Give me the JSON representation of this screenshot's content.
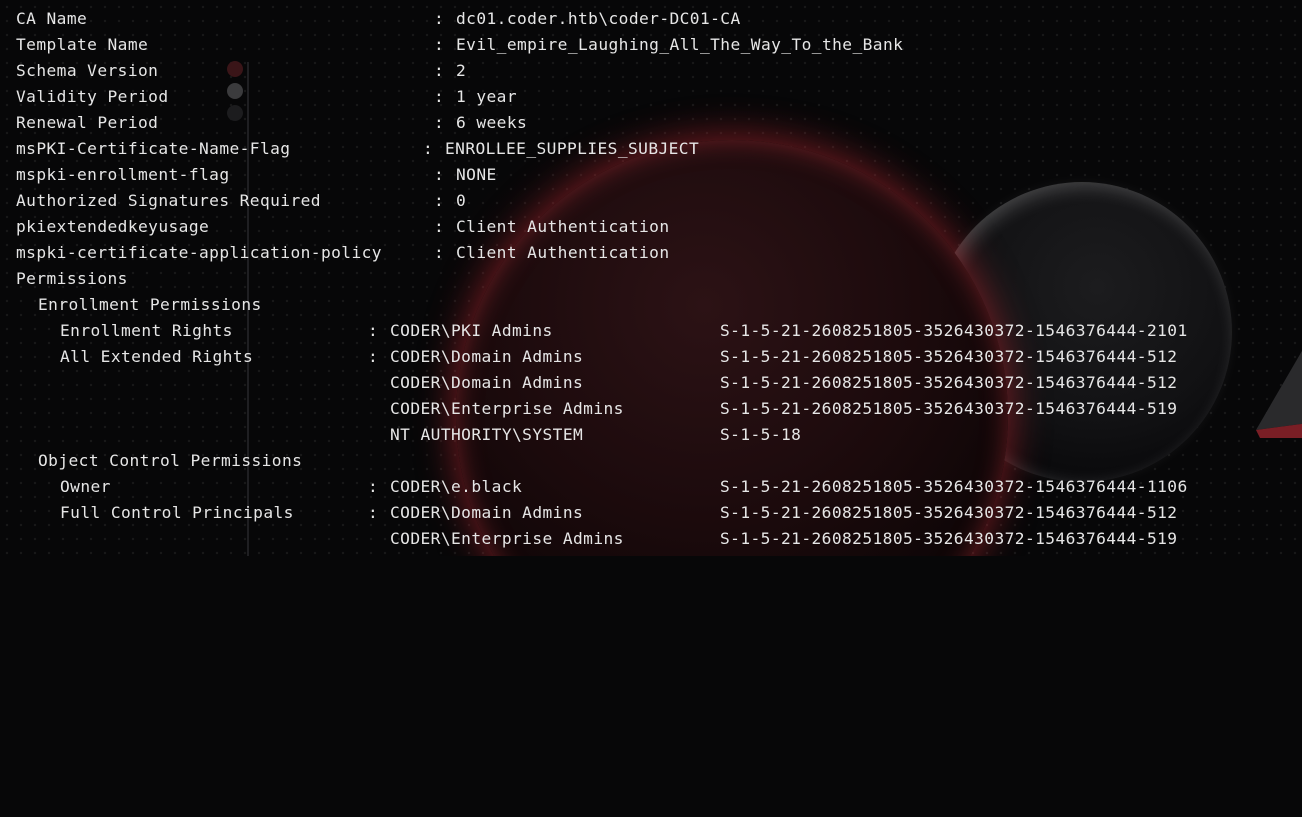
{
  "terminal": {
    "ca_name": {
      "key": "CA Name",
      "sep": ":",
      "value": "dc01.coder.htb\\coder-DC01-CA"
    },
    "template_name": {
      "key": "Template Name",
      "sep": ":",
      "value": "Evil_empire_Laughing_All_The_Way_To_the_Bank"
    },
    "schema_version": {
      "key": "Schema Version",
      "sep": ":",
      "value": "2"
    },
    "validity_period": {
      "key": "Validity Period",
      "sep": ":",
      "value": "1 year"
    },
    "renewal_period": {
      "key": "Renewal Period",
      "sep": ":",
      "value": "6 weeks"
    },
    "name_flag": {
      "key": "msPKI-Certificate-Name-Flag",
      "sep": ":",
      "value": "ENROLLEE_SUPPLIES_SUBJECT"
    },
    "enrollment_flag": {
      "key": "mspki-enrollment-flag",
      "sep": ":",
      "value": "NONE"
    },
    "authorized_signatures": {
      "key": "Authorized Signatures Required",
      "sep": ":",
      "value": "0"
    },
    "extended_key_usage": {
      "key": "pkiextendedkeyusage",
      "sep": ":",
      "value": "Client Authentication"
    },
    "application_policy": {
      "key": "mspki-certificate-application-policy",
      "sep": ":",
      "value": "Client Authentication"
    },
    "permissions_header": "Permissions",
    "enrollment_permissions": {
      "header": "Enrollment Permissions",
      "enrollment_rights": {
        "label": "Enrollment Rights",
        "sep": ":",
        "entries": [
          {
            "principal": "CODER\\PKI Admins",
            "sid": "S-1-5-21-2608251805-3526430372-1546376444-2101"
          }
        ]
      },
      "all_extended_rights": {
        "label": "All Extended Rights",
        "sep": ":",
        "entries": [
          {
            "principal": "CODER\\Domain Admins",
            "sid": "S-1-5-21-2608251805-3526430372-1546376444-512"
          },
          {
            "principal": "CODER\\Domain Admins",
            "sid": "S-1-5-21-2608251805-3526430372-1546376444-512"
          },
          {
            "principal": "CODER\\Enterprise Admins",
            "sid": "S-1-5-21-2608251805-3526430372-1546376444-519"
          },
          {
            "principal": "NT AUTHORITY\\SYSTEM",
            "sid": "S-1-5-18"
          }
        ]
      }
    },
    "object_control_permissions": {
      "header": "Object Control Permissions",
      "owner": {
        "label": "Owner",
        "sep": ":",
        "entries": [
          {
            "principal": "CODER\\e.black",
            "sid": "S-1-5-21-2608251805-3526430372-1546376444-1106"
          }
        ]
      },
      "full_control": {
        "label": "Full Control Principals",
        "sep": ":",
        "entries": [
          {
            "principal": "CODER\\Domain Admins",
            "sid": "S-1-5-21-2608251805-3526430372-1546376444-512"
          },
          {
            "principal": "CODER\\Enterprise Admins",
            "sid": "S-1-5-21-2608251805-3526430372-1546376444-519"
          }
        ]
      }
    }
  },
  "wallpaper": {
    "accent_red": "#af2630",
    "planet_grey": "#1c1c1e",
    "text_color": "#e6e6e6",
    "background": "#070708"
  }
}
